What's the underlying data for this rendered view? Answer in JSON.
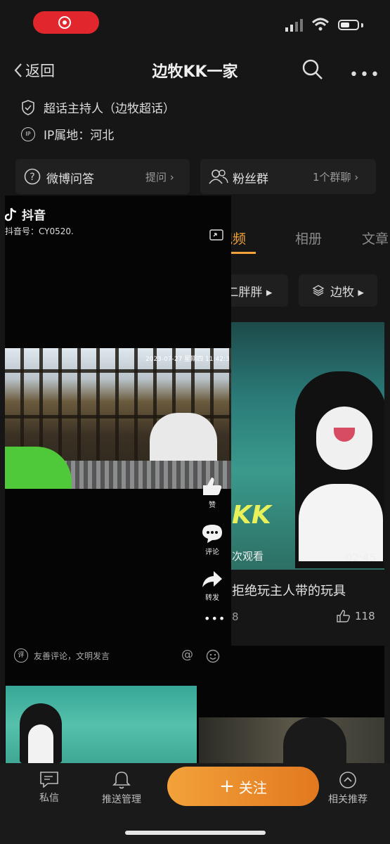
{
  "status": {
    "icon_record": "record-icon",
    "icon_signal": "signal-icon",
    "icon_wifi": "wifi-icon",
    "icon_battery": "battery-icon"
  },
  "nav": {
    "back_label": "返回",
    "title": "边牧KK一家"
  },
  "info": {
    "host": "超话主持人（边牧超话）",
    "ip": "IP属地：河北",
    "ip_badge": "IP"
  },
  "cards": {
    "qa": {
      "label": "微博问答",
      "action": "提问 ›"
    },
    "fans": {
      "label": "粉丝群",
      "action": "1个群聊 ›"
    }
  },
  "tabs": [
    "视频",
    "相册",
    "文章"
  ],
  "chips": [
    "二胖胖 ▸",
    "边牧 ▸"
  ],
  "video_card": {
    "watermark": "KK",
    "views": "次观看",
    "duration": "02:45",
    "title": "拒绝玩主人带的玩具",
    "comment_count": "8",
    "like_count": "118"
  },
  "overlay": {
    "app_name": "抖音",
    "douyin_id": "抖音号：CY0520.",
    "timestamp": "2023-07-27 星期四 11:42:3",
    "like_label": "赞",
    "comment_label": "评论",
    "share_label": "转发",
    "comment_placeholder": "友善评论，文明发言",
    "comment_badge": "评"
  },
  "bottom": {
    "dm_label": "私信",
    "push_label": "推送管理",
    "follow_label": "关注",
    "related_label": "相关推荐"
  },
  "colors": {
    "accent": "#f3a33a",
    "record_red": "#e1262d",
    "background": "#161616"
  }
}
